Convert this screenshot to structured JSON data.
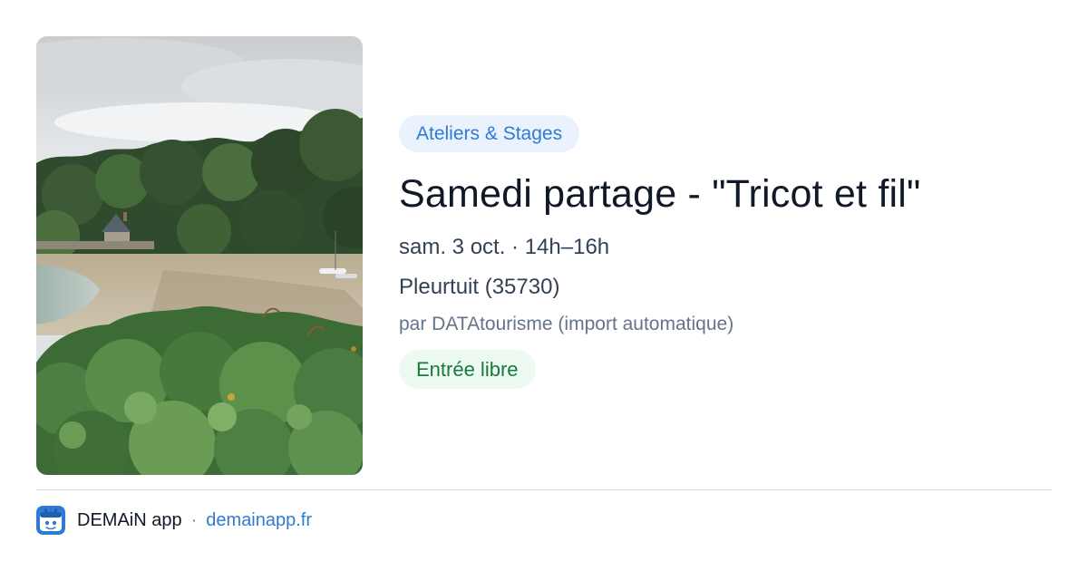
{
  "event": {
    "category": "Ateliers & Stages",
    "title": "Samedi partage - \"Tricot et fil\"",
    "datetime": "sam. 3 oct. · 14h–16h",
    "location": "Pleurtuit (35730)",
    "source": "par DATAtourisme (import automatique)",
    "price": "Entrée libre",
    "image": {
      "subject": "coastal-cove-photo"
    }
  },
  "footer": {
    "app_name": "DEMAiN app",
    "separator": "·",
    "domain": "demainapp.fr",
    "logo_icon": "demain-app-logo-icon"
  },
  "colors": {
    "accent_blue": "#2f7bd3",
    "category_bg": "#eaf2fd",
    "price_green": "#177a3c",
    "price_bg": "#edfaf1"
  }
}
